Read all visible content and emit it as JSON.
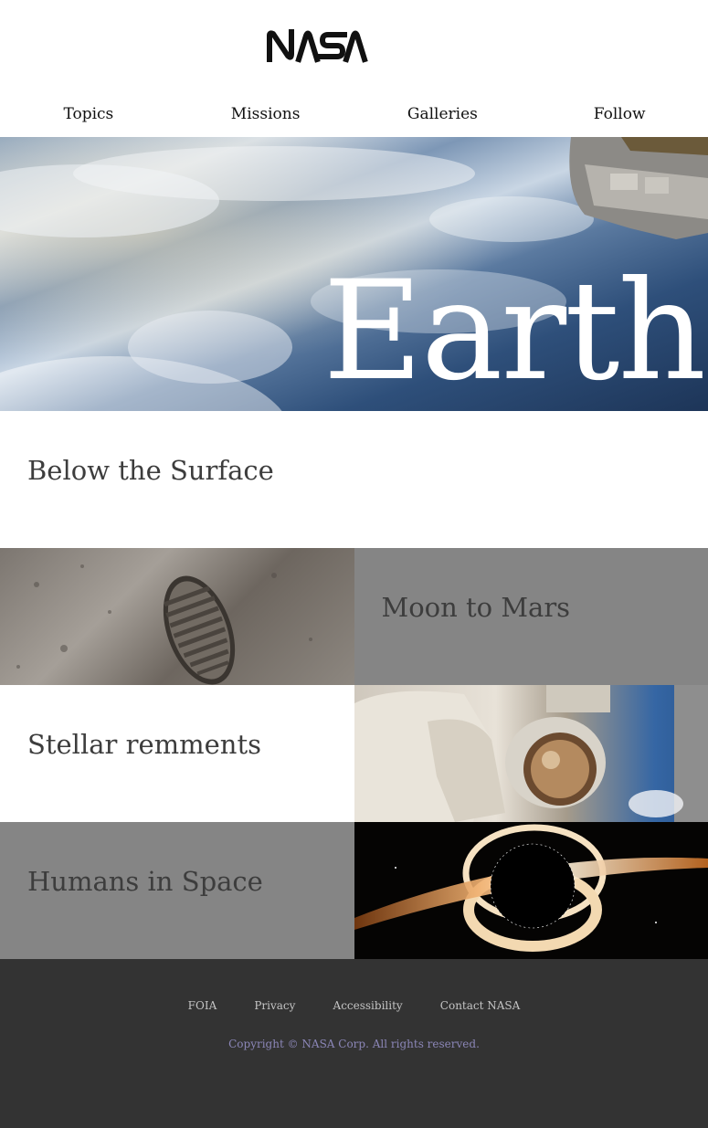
{
  "brand": {
    "logo_text": "NASA"
  },
  "nav": {
    "items": [
      "Topics",
      "Missions",
      "Galleries",
      "Follow"
    ]
  },
  "hero": {
    "title": "Earth"
  },
  "intro": {
    "heading": "Below the Surface"
  },
  "grid": {
    "moon_to_mars": "Moon to Mars",
    "stellar": "Stellar remments",
    "humans": "Humans in Space"
  },
  "footer": {
    "links": [
      "FOIA",
      "Privacy",
      "Accessibility",
      "Contact NASA"
    ],
    "copyright": "Copyright © NASA Corp. All rights reserved."
  },
  "colors": {
    "footer_bg": "#333333",
    "gray_tile": "#858585",
    "copyright_text": "#8b86b7"
  }
}
